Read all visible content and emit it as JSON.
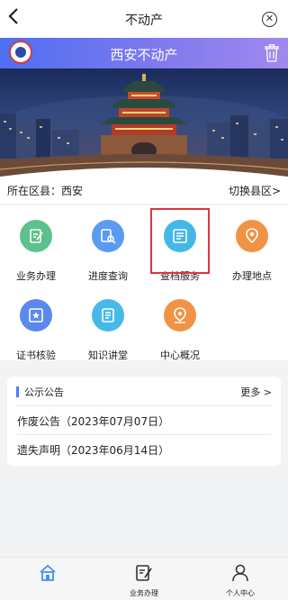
{
  "nav": {
    "title": "不动产",
    "back_icon": "chevron-left-icon",
    "close_icon": "close-circle-icon"
  },
  "header": {
    "title": "西安不动产",
    "emblem_icon": "emblem-icon",
    "trash_icon": "trash-icon",
    "accent": "#4d6ff2"
  },
  "location": {
    "label": "所在区县：西安",
    "switch_label": "切换县区>"
  },
  "services": [
    {
      "label": "业务办理",
      "icon": "edit-document-icon",
      "color": "#5cc28a"
    },
    {
      "label": "进度查询",
      "icon": "document-search-icon",
      "color": "#5a9af0"
    },
    {
      "label": "查档服务",
      "icon": "archive-icon",
      "color": "#43b7e6"
    },
    {
      "label": "办理地点",
      "icon": "map-pin-icon",
      "color": "#f09345"
    },
    {
      "label": "证书核验",
      "icon": "certificate-star-icon",
      "color": "#5a88ee"
    },
    {
      "label": "知识讲堂",
      "icon": "book-icon",
      "color": "#46b9e8"
    },
    {
      "label": "中心概况",
      "icon": "location-icon",
      "color": "#f09345"
    }
  ],
  "highlight_color": "#d9373b",
  "notice": {
    "title": "公示公告",
    "more_label": "更多 >",
    "items": [
      "作废公告（2023年07月07日）",
      "遗失声明（2023年06月14日）"
    ]
  },
  "tabbar": [
    {
      "label": "",
      "icon": "home-icon",
      "active": true
    },
    {
      "label": "业务办理",
      "icon": "edit-document-icon",
      "active": false
    },
    {
      "label": "个人中心",
      "icon": "user-icon",
      "active": false
    }
  ]
}
